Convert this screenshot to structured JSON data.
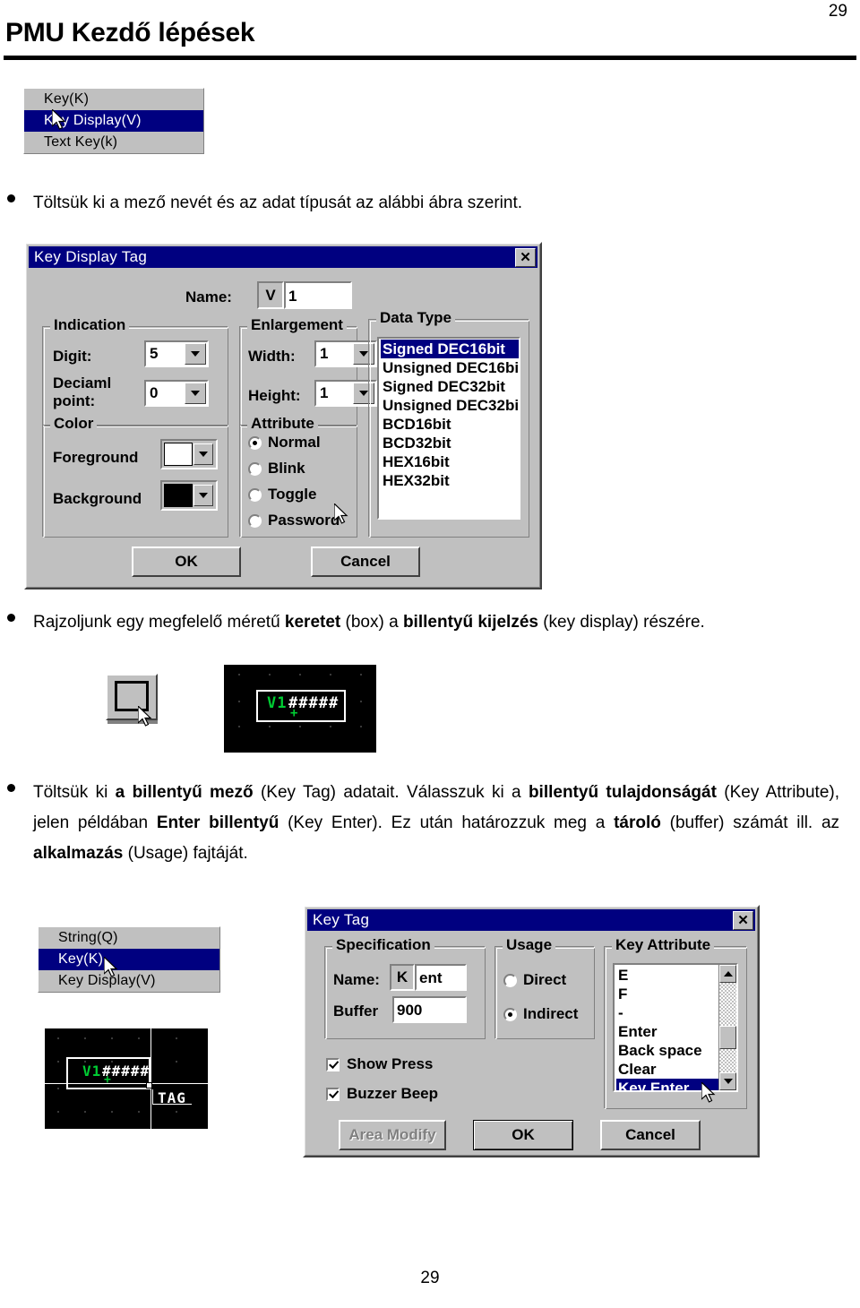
{
  "page": {
    "number_top": "29",
    "number_bottom": "29",
    "title": "PMU Kezdő lépések"
  },
  "menu_top": {
    "items": [
      {
        "label": "Key(K)",
        "selected": false
      },
      {
        "label": "Key Display(V)",
        "selected": true
      },
      {
        "label": "Text Key(k)",
        "selected": false
      }
    ]
  },
  "menu_bottom": {
    "items": [
      {
        "label": "String(Q)",
        "selected": false
      },
      {
        "label": "Key(K)",
        "selected": true
      },
      {
        "label": "Key Display(V)",
        "selected": false
      }
    ]
  },
  "paragraphs": {
    "p1": "Töltsük ki a mező nevét és az adat típusát az alábbi ábra szerint.",
    "p2_part1": "Rajzoljunk egy megfelelő méretű ",
    "p2_bold1": "keretet",
    "p2_part2": " (box) a ",
    "p2_bold2": "billentyű kijelzés",
    "p2_part3": " (key display) részére.",
    "p3_part1": "Töltsük ki ",
    "p3_bold1": "a billentyű mező",
    "p3_part2": " (Key Tag) adatait. Válasszuk ki a ",
    "p3_bold2": "billentyű tulajdonságát",
    "p3_part3": " (Key Attribute), jelen példában ",
    "p3_bold3": "Enter billentyű",
    "p3_part4": " (Key Enter). Ez után határozzuk meg a ",
    "p3_bold4": "tároló",
    "p3_part5": " (buffer) számát ill. az ",
    "p3_bold5": "alkalmazás",
    "p3_part6": " (Usage) fajtáját."
  },
  "key_display_dialog": {
    "title": "Key Display Tag",
    "close_label": "✕",
    "name_label": "Name:",
    "name_prefix": "V",
    "name_value": "1",
    "indication": {
      "group_label": "Indication",
      "digit_label": "Digit:",
      "digit_value": "5",
      "decimal_label_line1": "Deciaml",
      "decimal_label_line2": "point:",
      "decimal_value": "0"
    },
    "enlargement": {
      "group_label": "Enlargement",
      "width_label": "Width:",
      "width_value": "1",
      "height_label": "Height:",
      "height_value": "1"
    },
    "color": {
      "group_label": "Color",
      "foreground_label": "Foreground",
      "foreground_value": "#ffffff",
      "background_label": "Background",
      "background_value": "#000000"
    },
    "attribute": {
      "group_label": "Attribute",
      "options": [
        {
          "label": "Normal",
          "selected": true
        },
        {
          "label": "Blink",
          "selected": false
        },
        {
          "label": "Toggle",
          "selected": false
        },
        {
          "label": "Password",
          "selected": false
        }
      ]
    },
    "data_type": {
      "group_label": "Data Type",
      "items": [
        {
          "label": "Signed DEC16bit",
          "selected": true
        },
        {
          "label": "Unsigned DEC16bit",
          "selected": false
        },
        {
          "label": "Signed DEC32bit",
          "selected": false
        },
        {
          "label": "Unsigned DEC32bit",
          "selected": false
        },
        {
          "label": "BCD16bit",
          "selected": false
        },
        {
          "label": "BCD32bit",
          "selected": false
        },
        {
          "label": "HEX16bit",
          "selected": false
        },
        {
          "label": "HEX32bit",
          "selected": false
        }
      ]
    },
    "ok_label": "OK",
    "cancel_label": "Cancel"
  },
  "key_tag_dialog": {
    "title": "Key Tag",
    "close_label": "✕",
    "specification": {
      "group_label": "Specification",
      "name_label": "Name:",
      "name_prefix": "K",
      "name_value": "ent",
      "buffer_label": "Buffer",
      "buffer_value": "900"
    },
    "usage": {
      "group_label": "Usage",
      "options": [
        {
          "label": "Direct",
          "selected": false
        },
        {
          "label": "Indirect",
          "selected": true
        }
      ]
    },
    "key_attribute": {
      "group_label": "Key Attribute",
      "items": [
        {
          "label": "E",
          "selected": false
        },
        {
          "label": "F",
          "selected": false
        },
        {
          "label": "-",
          "selected": false
        },
        {
          "label": "Enter",
          "selected": false
        },
        {
          "label": "Back space",
          "selected": false
        },
        {
          "label": "Clear",
          "selected": false
        },
        {
          "label": "Key Enter",
          "selected": true
        }
      ]
    },
    "checkboxes": [
      {
        "label": "Show Press",
        "checked": true
      },
      {
        "label": "Buzzer Beep",
        "checked": true
      }
    ],
    "area_modify_label": "Area Modify",
    "ok_label": "OK",
    "cancel_label": "Cancel"
  },
  "pmu_preview_1": {
    "tag_name": "V1",
    "digits": "#####",
    "cursor_mark": "+",
    "tag_color": "#00cc33",
    "digit_color": "#ffffff"
  },
  "pmu_preview_2": {
    "tag_name": "V1",
    "digits": "#####",
    "cursor_mark": "+",
    "tag_label": "TAG",
    "tag_color": "#00cc33",
    "digit_color": "#ffffff"
  }
}
